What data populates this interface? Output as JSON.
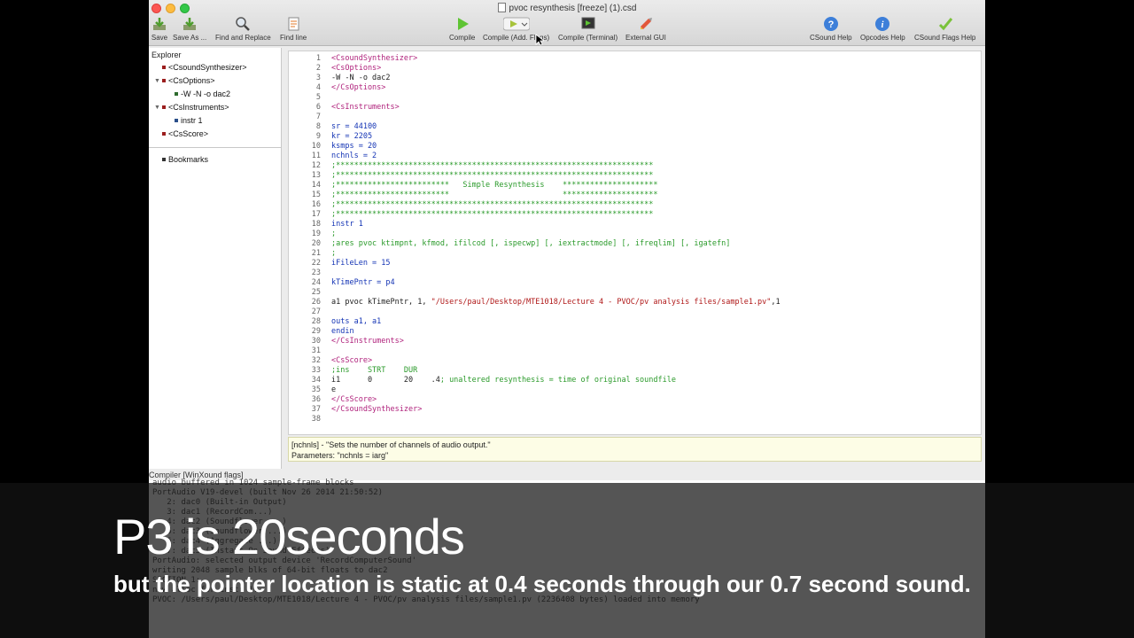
{
  "window": {
    "title": "pvoc resynthesis [freeze] (1).csd"
  },
  "toolbar": {
    "left": [
      {
        "label": "Save",
        "icon": "save-icon"
      },
      {
        "label": "Save As ...",
        "icon": "save-as-icon"
      },
      {
        "label": "Find and Replace",
        "icon": "find-replace-icon"
      },
      {
        "label": "Find line",
        "icon": "find-line-icon"
      }
    ],
    "center": [
      {
        "label": "Compile",
        "icon": "play-icon"
      },
      {
        "label": "Compile (Add. Flags)",
        "icon": "play-flags-icon"
      },
      {
        "label": "Compile (Terminal)",
        "icon": "terminal-icon"
      },
      {
        "label": "External GUI",
        "icon": "external-gui-icon"
      }
    ],
    "right": [
      {
        "label": "CSound Help",
        "icon": "help-icon"
      },
      {
        "label": "Opcodes Help",
        "icon": "info-icon"
      },
      {
        "label": "CSound Flags Help",
        "icon": "check-icon"
      }
    ]
  },
  "explorer": {
    "heading": "Explorer",
    "items": [
      {
        "label": "<CsoundSynthesizer>"
      },
      {
        "label": "<CsOptions>"
      },
      {
        "label": "-W -N -o dac2"
      },
      {
        "label": "<CsInstruments>"
      },
      {
        "label": "instr 1"
      },
      {
        "label": "<CsScore>"
      },
      {
        "label": "Bookmarks"
      }
    ]
  },
  "editor": {
    "line_numbers": [
      "1",
      "2",
      "3",
      "4",
      "5",
      "6",
      "7",
      "8",
      "9",
      "10",
      "11",
      "12",
      "13",
      "14",
      "15",
      "16",
      "17",
      "18",
      "19",
      "20",
      "21",
      "22",
      "23",
      "24",
      "25",
      "26",
      "27",
      "28",
      "29",
      "30",
      "31",
      "32",
      "33",
      "34",
      "35",
      "36",
      "37",
      "38"
    ],
    "lines": [
      "<CsoundSynthesizer>",
      "<CsOptions>",
      "-W -N -o dac2",
      "</CsOptions>",
      "",
      "<CsInstruments>",
      "",
      "sr = 44100",
      "kr = 2205",
      "ksmps = 20",
      "nchnls = 2",
      ";**********************************************************************",
      ";**********************************************************************",
      ";*************************   Simple Resynthesis    *********************",
      ";*************************                         *********************",
      ";**********************************************************************",
      ";**********************************************************************",
      "instr 1",
      ";",
      ";ares pvoc ktimpnt, kfmod, ifilcod [, ispecwp] [, iextractmode] [, ifreqlim] [, igatefn]",
      ";",
      "iFileLen = 15",
      "",
      "kTimePntr = p4",
      "",
      "a1 pvoc kTimePntr, 1, \"/Users/paul/Desktop/MTE1018/Lecture 4 - PVOC/pv analysis files/sample1.pv\",1",
      "",
      "outs a1, a1",
      "endin",
      "</CsInstruments>",
      "",
      "<CsScore>",
      ";ins    STRT    DUR",
      "i1      0       20    .4; unaltered resynthesis = time of original soundfile",
      "e",
      "</CsScore>",
      "</CsoundSynthesizer>",
      ""
    ]
  },
  "help_panel": {
    "line1": "[nchnls] - \"Sets the number of channels of audio output.\"",
    "line2": "Parameters: \"nchnls = iarg\""
  },
  "console": {
    "label": "Compiler [WinXound flags]",
    "lines": [
      "audio buffered in 1024 sample-frame blocks",
      "PortAudio V19-devel (built Nov 26 2014 21:50:52)",
      "   2: dac0 (Built-in Output)",
      "   3: dac1 (RecordCom...)",
      "   4: dac2 (Soundflower ...)",
      "   5: dac3 (Soundflower ...)",
      "   6: dac4 (Aggregate ...)",
      "   7: dac5 (Instant On Sound Effects)",
      "PortAudio: selected output device 'RecordComputerSound'",
      "writing 2048 sample blks of 64-bit floats to dac2",
      "SECTION 1:",
      "new alloc for instr 1:",
      "PVOC: /Users/paul/Desktop/MTE1018/Lecture 4 - PVOC/pv analysis files/sample1.pv (2236408 bytes) loaded into memory"
    ]
  },
  "caption": {
    "title": "P3 is 20seconds",
    "subtitle": "but the pointer location is static at 0.4 seconds through our 0.7 second sound."
  }
}
